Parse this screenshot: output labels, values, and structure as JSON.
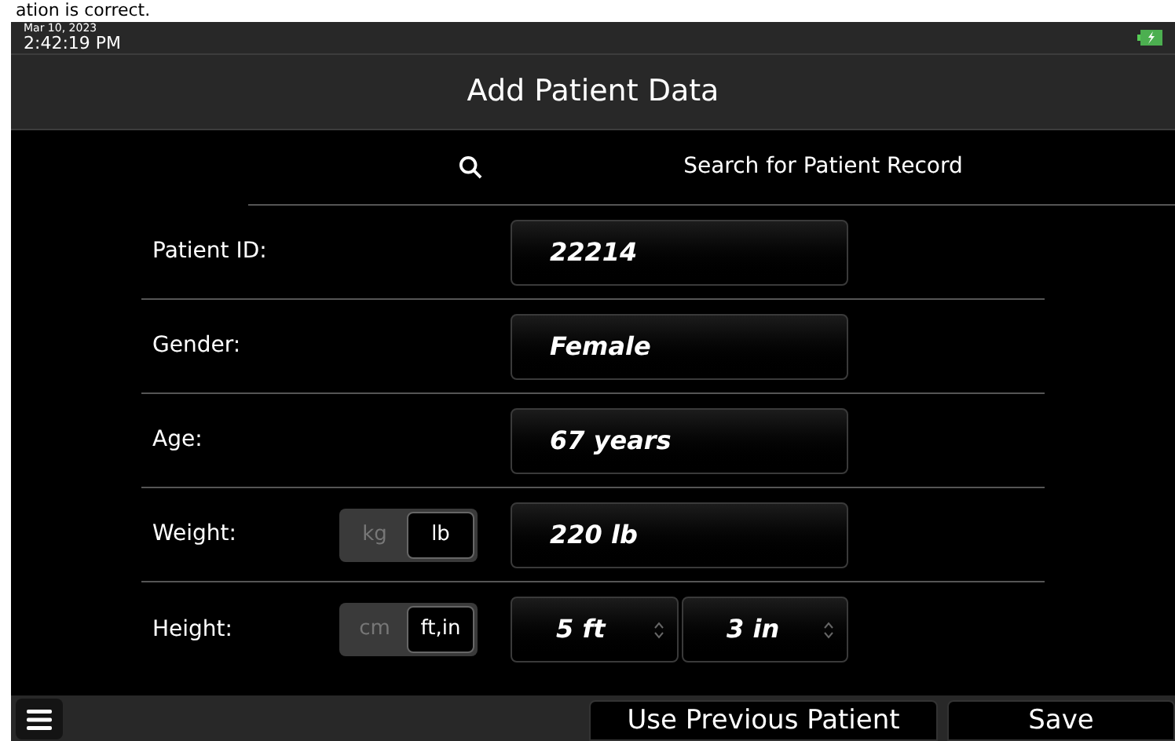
{
  "banner_text": "ation is correct.",
  "status_bar": {
    "date": "Mar 10, 2023",
    "time": "2:42:19 PM"
  },
  "title": "Add Patient Data",
  "search": {
    "label": "Search for Patient Record"
  },
  "fields": [
    {
      "kind": "text",
      "label": "Patient ID:",
      "value": "22214"
    },
    {
      "kind": "text",
      "label": "Gender:",
      "value": "Female"
    },
    {
      "kind": "text",
      "label": "Age:",
      "value": "67 years"
    },
    {
      "kind": "unit_text",
      "label": "Weight:",
      "units": [
        {
          "label": "kg",
          "selected": false
        },
        {
          "label": "lb",
          "selected": true
        }
      ],
      "value": "220 lb"
    },
    {
      "kind": "unit_spinners",
      "label": "Height:",
      "units": [
        {
          "label": "cm",
          "selected": false
        },
        {
          "label": "ft,in",
          "selected": true
        }
      ],
      "values": [
        "5 ft",
        "3 in"
      ]
    }
  ],
  "buttons": [
    "Use Previous Patient",
    "Save"
  ]
}
